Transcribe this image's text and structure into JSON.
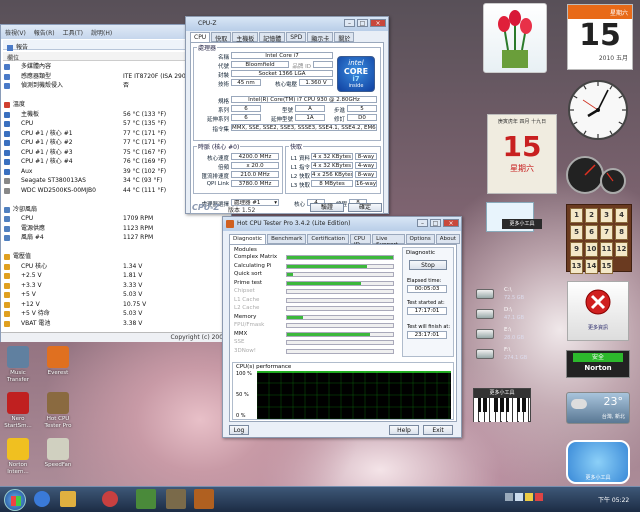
{
  "everest": {
    "menu": [
      "檢視(V)",
      "報告(R)",
      "工具(T)",
      "說明(H)"
    ],
    "tab": "報告",
    "col_label": "欄位",
    "rows": [
      {
        "l": "多媒體內容",
        "v": "",
        "t": "item",
        "c": "#4a7ac8"
      },
      {
        "l": "感應器類型",
        "v": "ITE IT8720F (ISA 290h)",
        "t": "item",
        "c": "#4a7ac8"
      },
      {
        "l": "偵測到機殼侵入",
        "v": "否",
        "t": "item",
        "c": "#4a7ac8"
      },
      {
        "l": "",
        "v": "",
        "t": "blank"
      },
      {
        "l": "溫度",
        "v": "",
        "t": "sec",
        "c": "#d04030"
      },
      {
        "l": "主機板",
        "v": "56 °C (133 °F)",
        "t": "item",
        "c": "#3a70c0"
      },
      {
        "l": "CPU",
        "v": "57 °C (135 °F)",
        "t": "item",
        "c": "#3a70c0"
      },
      {
        "l": "CPU #1 / 核心 #1",
        "v": "77 °C (171 °F)",
        "t": "item",
        "c": "#3a70c0"
      },
      {
        "l": "CPU #1 / 核心 #2",
        "v": "77 °C (171 °F)",
        "t": "item",
        "c": "#3a70c0"
      },
      {
        "l": "CPU #1 / 核心 #3",
        "v": "75 °C (167 °F)",
        "t": "item",
        "c": "#3a70c0"
      },
      {
        "l": "CPU #1 / 核心 #4",
        "v": "76 °C (169 °F)",
        "t": "item",
        "c": "#3a70c0"
      },
      {
        "l": "Aux",
        "v": "39 °C (102 °F)",
        "t": "item",
        "c": "#3a70c0"
      },
      {
        "l": "Seagate ST380013AS",
        "v": "34 °C (93 °F)",
        "t": "item",
        "c": "#888"
      },
      {
        "l": "WDC WD2500KS-00MJB0",
        "v": "44 °C (111 °F)",
        "t": "item",
        "c": "#888"
      },
      {
        "l": "",
        "v": "",
        "t": "blank"
      },
      {
        "l": "冷卻風扇",
        "v": "",
        "t": "sec",
        "c": "#5080c0"
      },
      {
        "l": "CPU",
        "v": "1709 RPM",
        "t": "item",
        "c": "#5080c0"
      },
      {
        "l": "電源供應",
        "v": "1123 RPM",
        "t": "item",
        "c": "#5080c0"
      },
      {
        "l": "風扇 #4",
        "v": "1127 RPM",
        "t": "item",
        "c": "#5080c0"
      },
      {
        "l": "",
        "v": "",
        "t": "blank"
      },
      {
        "l": "電壓值",
        "v": "",
        "t": "sec",
        "c": "#e0a020"
      },
      {
        "l": "CPU 核心",
        "v": "1.34 V",
        "t": "item",
        "c": "#e0a020"
      },
      {
        "l": "+2.5 V",
        "v": "1.81 V",
        "t": "item",
        "c": "#e0a020"
      },
      {
        "l": "+3.3 V",
        "v": "3.33 V",
        "t": "item",
        "c": "#e0a020"
      },
      {
        "l": "+5 V",
        "v": "5.03 V",
        "t": "item",
        "c": "#e0a020"
      },
      {
        "l": "+12 V",
        "v": "10.75 V",
        "t": "item",
        "c": "#e0a020"
      },
      {
        "l": "+5 V 待命",
        "v": "5.03 V",
        "t": "item",
        "c": "#e0a020"
      },
      {
        "l": "VBAT 電池",
        "v": "3.38 V",
        "t": "item",
        "c": "#e0a020"
      }
    ],
    "status": "Copyright (c) 2003-"
  },
  "cpuz": {
    "title": "CPU-Z",
    "tabs": [
      "CPU",
      "快取",
      "主機板",
      "記憶體",
      "SPD",
      "顯示卡",
      "關於"
    ],
    "proc_legend": "處理器",
    "name_l": "名稱",
    "name_v": "Intel Core i7",
    "code_l": "代號",
    "code_v": "Bloomfield",
    "brand_l": "品牌 ID",
    "pkg_l": "封裝",
    "pkg_v": "Socket 1366 LGA",
    "tech_l": "技術",
    "tech_v": "45 nm",
    "volt_l": "核心電壓",
    "volt_v": "1.360 V",
    "spec_l": "規格",
    "spec_v": "Intel(R) Core(TM) i7 CPU        930  @ 2.80GHz",
    "fam_l": "系列",
    "fam_v": "6",
    "model_l": "型號",
    "model_v": "A",
    "step_l": "步進",
    "step_v": "5",
    "extfam_l": "延伸系列",
    "extfam_v": "6",
    "extmod_l": "延伸型號",
    "extmod_v": "1A",
    "rev_l": "修訂",
    "rev_v": "D0",
    "inst_l": "指令集",
    "inst_v": "MMX, SSE, SSE2, SSE3, SSSE3, SSE4.1, SSE4.2, EM64T",
    "clock_legend": "時脈 (核心 #0)",
    "cspeed_l": "核心速度",
    "cspeed_v": "4200.0 MHz",
    "mult_l": "倍頻",
    "mult_v": "x 20.0",
    "bus_l": "匯流排速度",
    "bus_v": "210.0 MHz",
    "qpi_l": "QPI Link",
    "qpi_v": "3780.0 MHz",
    "cache_legend": "快取",
    "l1d_l": "L1 資料",
    "l1d_v": "4 x 32 KBytes",
    "l1d_w": "8-way",
    "l1i_l": "L1 指令",
    "l1i_v": "4 x 32 KBytes",
    "l1i_w": "4-way",
    "l2_l": "L2 快取",
    "l2_v": "4 x 256 KBytes",
    "l2_w": "8-way",
    "l3_l": "L3 快取",
    "l3_v": "8 MBytes",
    "l3_w": "16-way",
    "sel_l": "處理器選擇",
    "sel_v": "處理器 #1",
    "cores_l": "核心",
    "cores_v": "4",
    "threads_l": "線程",
    "threads_v": "8",
    "logo_intel": "intel",
    "logo_core": "CORE",
    "logo_i7": "i7",
    "logo_inside": "inside",
    "footer_brand": "CPU-Z",
    "ver": "版本 1.52",
    "validate": "驗證",
    "ok": "確定"
  },
  "hot": {
    "title": "Hot CPU Tester Pro 3.4.2 (Lite Edition)",
    "tabs": [
      "Diagnostic",
      "Benchmark",
      "Certification",
      "CPU ID",
      "Live Support",
      "Options",
      "About"
    ],
    "modules_l": "Modules",
    "modules": [
      {
        "n": "Complex Matrix",
        "p": 1,
        "en": true
      },
      {
        "n": "Calculating Pi",
        "p": 0.75,
        "en": true
      },
      {
        "n": "Quick sort",
        "p": 0.06,
        "en": true
      },
      {
        "n": "Prime test",
        "p": 0.7,
        "en": true
      },
      {
        "n": "Chipset",
        "p": 0,
        "en": false
      },
      {
        "n": "L1 Cache",
        "p": 0,
        "en": false
      },
      {
        "n": "L2 Cache",
        "p": 0,
        "en": false
      },
      {
        "n": "Memory",
        "p": 0.15,
        "en": true
      },
      {
        "n": "FPU/Fmask",
        "p": 0,
        "en": false
      },
      {
        "n": "MMX",
        "p": 0.78,
        "en": true
      },
      {
        "n": "SSE",
        "p": 0,
        "en": false
      },
      {
        "n": "3DNow!",
        "p": 0,
        "en": false
      }
    ],
    "diag_l": "Diagnostic",
    "stop": "Stop",
    "elapsed_l": "Elapsed time:",
    "elapsed_v": "00:05:03",
    "started_l": "Test started at:",
    "started_v": "17:17:01",
    "finish_l": "Test will finish at:",
    "finish_v": "23:17:01",
    "perf_l": "CPU(s) performance",
    "y100": "100 %",
    "y50": "50 %",
    "y0": "0 %",
    "log": "Log",
    "help": "Help",
    "exit": "Exit"
  },
  "gadgets": {
    "cal_weekday": "星期六",
    "cal_day": "15",
    "cal_month": "2010 五月",
    "lunar_top": "庚寅虎年 四月 十九日",
    "lunar_day": "15",
    "lunar_wd": "星期六",
    "drives": [
      {
        "n": "C:\\",
        "s": "72.5 GB"
      },
      {
        "n": "D:\\",
        "s": "47.1 GB"
      },
      {
        "n": "E:\\",
        "s": "28.0 GB"
      },
      {
        "n": "F:\\",
        "s": "274.1 GB"
      }
    ],
    "cpu_meter": "CPU",
    "tiles": [
      "1",
      "2",
      "3",
      "4",
      "5",
      "6",
      "7",
      "8",
      "9",
      "10",
      "11",
      "12",
      "13",
      "14",
      "15"
    ],
    "tools_label": "小工具",
    "tools_label2": "更多小工具",
    "security_l": "更多資訊",
    "norton_tag": "安全",
    "norton": "Norton",
    "weather_t": "23°",
    "weather_c": "台灣, 新北",
    "piano_l": "更多小工具",
    "corner_l": "更多小工具"
  },
  "desktop": {
    "icons": [
      {
        "n": "Music Transfer",
        "c": "#6080a0"
      },
      {
        "n": "Everest",
        "c": "#e07020"
      },
      {
        "n": "Nero StartSm...",
        "c": "#c02020"
      },
      {
        "n": "Hot CPU Tester Pro",
        "c": "#8a6a40"
      },
      {
        "n": "Norton Intern...",
        "c": "#f0c020"
      },
      {
        "n": "SpeedFan",
        "c": "#d0d0c0"
      }
    ],
    "clock": "下午 05:22",
    "watermark": "#717329"
  }
}
